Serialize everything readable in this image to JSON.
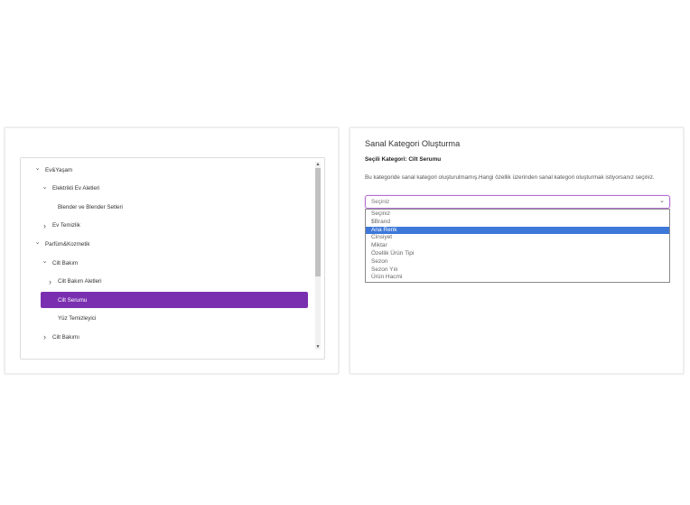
{
  "tree": {
    "items": [
      {
        "label": "Ev&Yaşam",
        "expander": "open",
        "level": 0,
        "selected": false
      },
      {
        "label": "Elektrikli Ev Aletleri",
        "expander": "open",
        "level": 1,
        "selected": false
      },
      {
        "label": "Blender ve Blender Setleri",
        "expander": "none",
        "level": 2,
        "selected": false
      },
      {
        "label": "Ev Temizlik",
        "expander": "closed",
        "level": 1,
        "selected": false
      },
      {
        "label": "Parfüm&Kozmetik",
        "expander": "open",
        "level": 0,
        "selected": false
      },
      {
        "label": "Cilt Bakım",
        "expander": "open",
        "level": 1,
        "selected": false
      },
      {
        "label": "Cilt Bakım Aletleri",
        "expander": "closed",
        "level": 2,
        "selected": false
      },
      {
        "label": "Cilt Serumu",
        "expander": "none",
        "level": 2,
        "selected": true
      },
      {
        "label": "Yüz Temizleyici",
        "expander": "none",
        "level": 2,
        "selected": false
      },
      {
        "label": "Cilt Bakımı",
        "expander": "closed",
        "level": 1,
        "selected": false
      }
    ],
    "scroll_fraction": 0.58
  },
  "virtual": {
    "title": "Sanal Kategori Oluşturma",
    "selected_category_label": "Seçili Kategori: ",
    "selected_category_value": "Cilt Serumu",
    "description": "Bu kategoride sanal kategori oluşturulmamış.Hangi özellik üzerinden sanal kategori oluşturmak istiyorsanız seçiniz.",
    "select_value": "Seçiniz",
    "options": [
      "Seçiniz",
      "$Brand",
      "Ana Renk",
      "Cinsiyet",
      "Miktar",
      "Özellik Ürün Tipi",
      "Sezon",
      "Sezon Yılı",
      "Ürün Hacmi"
    ],
    "highlighted_option": "Ana Renk"
  },
  "colors": {
    "selected_bg": "#7a2fb0",
    "highlight_bg": "#3d78d8",
    "select_border": "#b56fd1"
  },
  "icons": {
    "expanded": "chevron-down-icon",
    "collapsed": "chevron-right-icon",
    "select": "chevron-down-icon"
  }
}
